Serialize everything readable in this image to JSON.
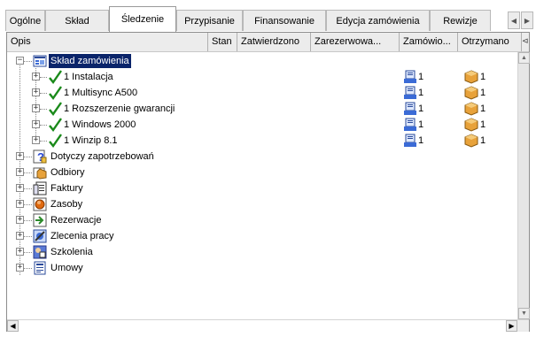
{
  "tabs": [
    {
      "label": "Ogólne",
      "active": false
    },
    {
      "label": "Skład",
      "active": false
    },
    {
      "label": "Śledzenie",
      "active": true
    },
    {
      "label": "Przypisanie",
      "active": false
    },
    {
      "label": "Finansowanie",
      "active": false
    },
    {
      "label": "Edycja zamówienia",
      "active": false
    },
    {
      "label": "Rewizje",
      "active": false
    }
  ],
  "tab_scroll_left": "◀",
  "tab_scroll_right": "▶",
  "columns": [
    "Opis",
    "Stan",
    "Zatwierdzono",
    "Zarezerwowa...",
    "Zamówio...",
    "Otrzymano"
  ],
  "column_extra_glyph": "⊲",
  "tree": {
    "root": {
      "label": "Skład zamówienia",
      "expanded": true,
      "selected": true,
      "icon": "order-composition-icon"
    },
    "children": [
      {
        "label": "1 Instalacja",
        "ordered": "1",
        "received": "1",
        "icon": "checkmark-icon"
      },
      {
        "label": "1 Multisync A500",
        "ordered": "1",
        "received": "1",
        "icon": "checkmark-icon"
      },
      {
        "label": "1 Rozszerzenie gwarancji",
        "ordered": "1",
        "received": "1",
        "icon": "checkmark-icon"
      },
      {
        "label": "1 Windows 2000",
        "ordered": "1",
        "received": "1",
        "icon": "checkmark-icon"
      },
      {
        "label": "1 Winzip 8.1",
        "ordered": "1",
        "received": "1",
        "icon": "checkmark-icon"
      }
    ],
    "groups": [
      {
        "label": "Dotyczy zapotrzebowań",
        "icon": "request-icon"
      },
      {
        "label": "Odbiory",
        "icon": "receipt-icon"
      },
      {
        "label": "Faktury",
        "icon": "invoice-icon"
      },
      {
        "label": "Zasoby",
        "icon": "asset-icon"
      },
      {
        "label": "Rezerwacje",
        "icon": "reservation-icon"
      },
      {
        "label": "Zlecenia pracy",
        "icon": "work-order-icon"
      },
      {
        "label": "Szkolenia",
        "icon": "training-icon"
      },
      {
        "label": "Umowy",
        "icon": "contract-icon"
      }
    ]
  },
  "expand_plus": "+",
  "expand_minus": "−",
  "scroll_up": "▲",
  "scroll_down": "▼",
  "scroll_left": "◀",
  "scroll_right": "▶",
  "colors": {
    "selection": "#0a246a",
    "check": "#1a8a1a"
  }
}
